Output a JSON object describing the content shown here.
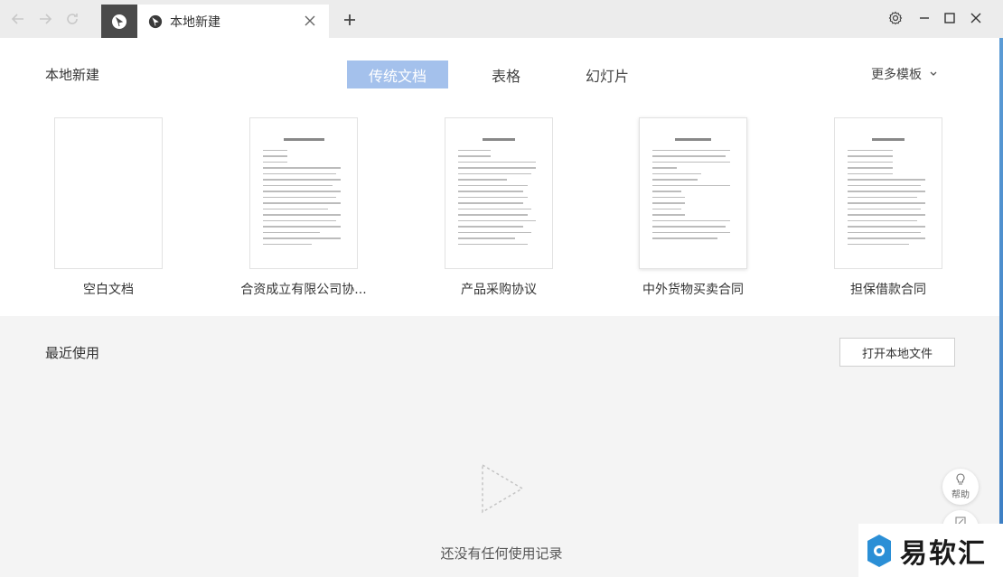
{
  "tabs": {
    "doc_title": "本地新建",
    "new_tab_symbol": "+"
  },
  "header": {
    "title": "本地新建",
    "types": [
      {
        "label": "传统文档",
        "active": true
      },
      {
        "label": "表格",
        "active": false
      },
      {
        "label": "幻灯片",
        "active": false
      }
    ],
    "more_templates": "更多模板"
  },
  "templates": [
    {
      "label": "空白文档",
      "blank": true
    },
    {
      "label": "合资成立有限公司协...",
      "blank": false
    },
    {
      "label": "产品采购协议",
      "blank": false
    },
    {
      "label": "中外货物买卖合同",
      "blank": false
    },
    {
      "label": "担保借款合同",
      "blank": false
    }
  ],
  "recent": {
    "title": "最近使用",
    "open_local": "打开本地文件",
    "empty_text": "还没有任何使用记录"
  },
  "help": {
    "label": "帮助"
  },
  "watermark": {
    "text": "易软汇"
  },
  "colors": {
    "active_tab": "#a4c1ec",
    "home_tab": "#4a4a4a",
    "titlebar": "#ececec"
  }
}
